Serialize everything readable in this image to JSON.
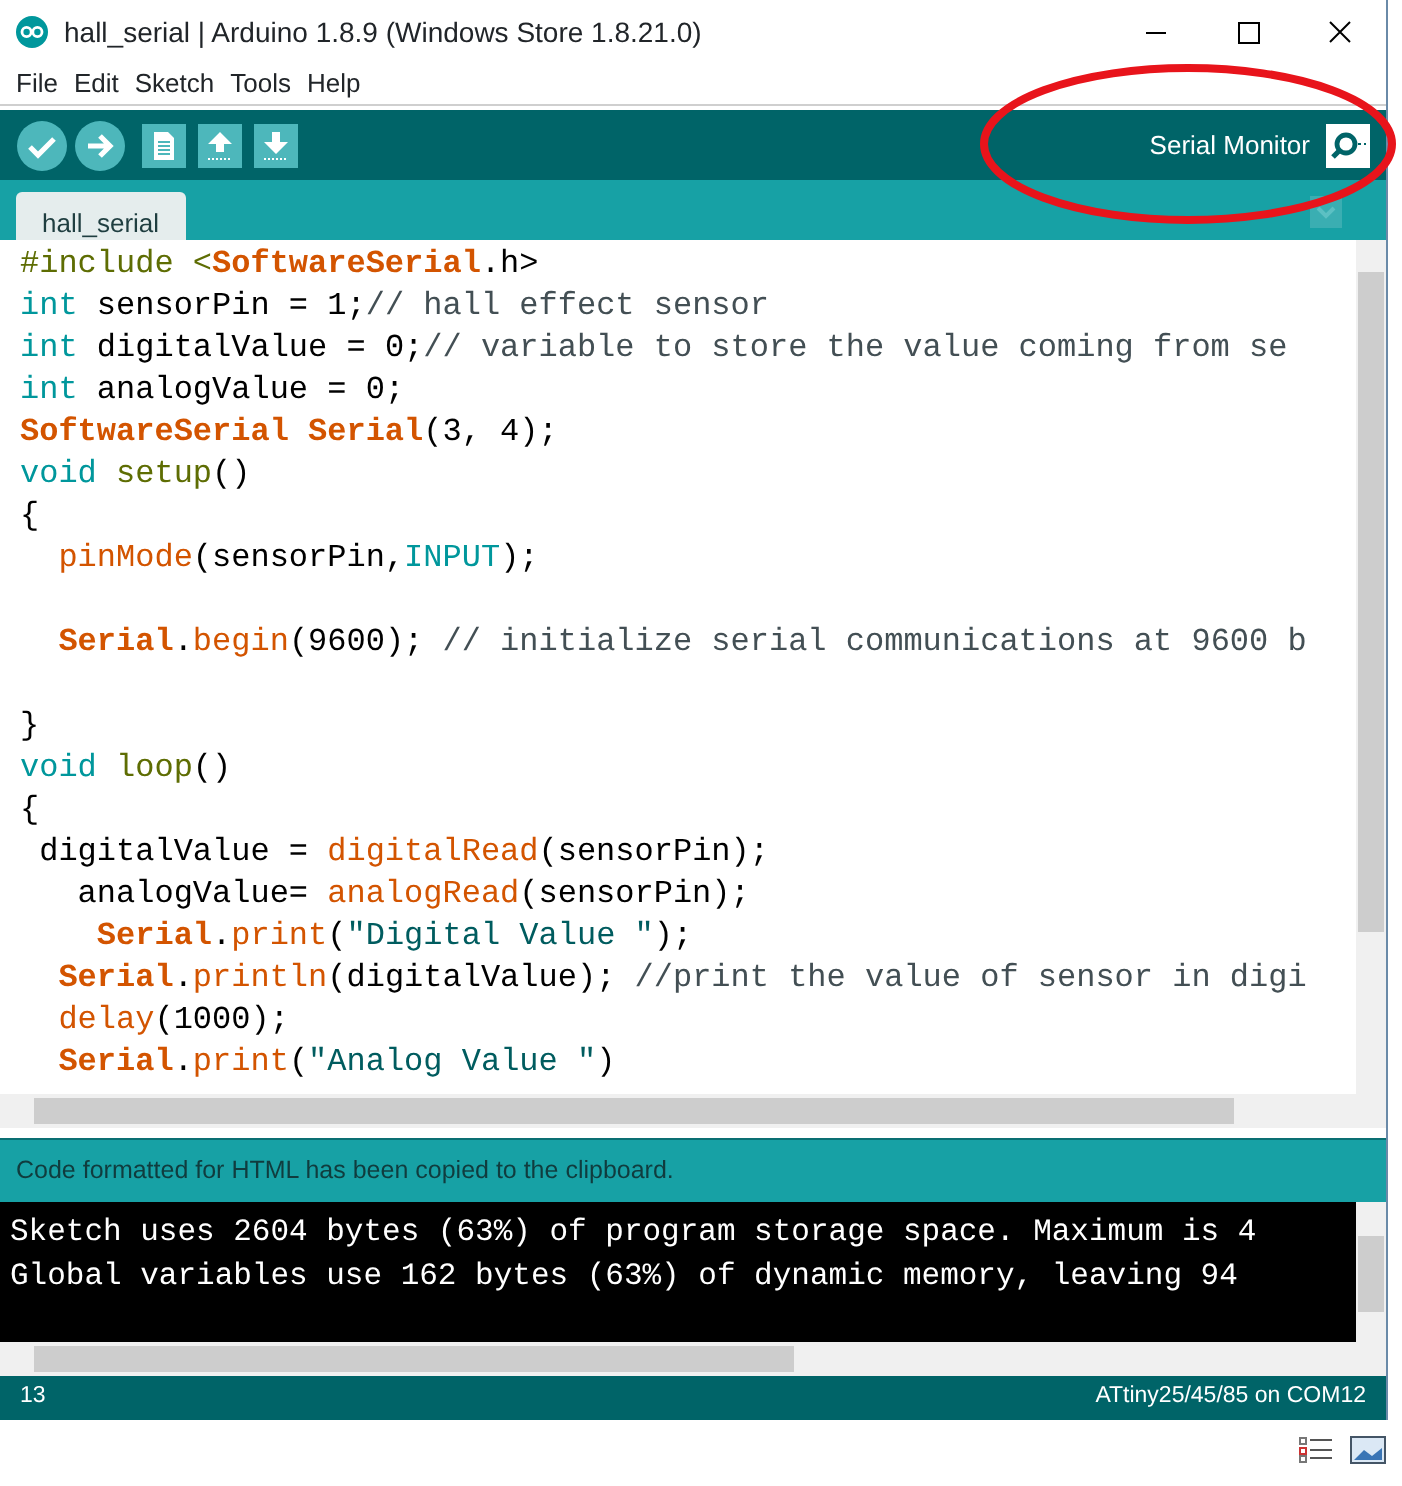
{
  "window": {
    "title": "hall_serial | Arduino 1.8.9 (Windows Store 1.8.21.0)"
  },
  "menu": [
    "File",
    "Edit",
    "Sketch",
    "Tools",
    "Help"
  ],
  "toolbar": {
    "serial_monitor_label": "Serial Monitor"
  },
  "tabs": [
    {
      "label": "hall_serial",
      "selected": true
    }
  ],
  "editor": {
    "lines": [
      {
        "kind": "code",
        "tokens": [
          {
            "kind": "preprocessor",
            "text": "#include <"
          },
          {
            "kind": "class",
            "text": "SoftwareSerial"
          },
          {
            "kind": "plain",
            "text": ".h>"
          }
        ]
      },
      {
        "kind": "code",
        "tokens": [
          {
            "kind": "type",
            "text": "int"
          },
          {
            "kind": "plain",
            "text": " sensorPin = 1;"
          },
          {
            "kind": "comment",
            "text": "// hall effect sensor"
          }
        ]
      },
      {
        "kind": "code",
        "tokens": [
          {
            "kind": "type",
            "text": "int"
          },
          {
            "kind": "plain",
            "text": " digitalValue = 0;"
          },
          {
            "kind": "comment",
            "text": "// variable to store the value coming from se"
          }
        ]
      },
      {
        "kind": "code",
        "tokens": [
          {
            "kind": "type",
            "text": "int"
          },
          {
            "kind": "plain",
            "text": " analogValue = 0;"
          }
        ]
      },
      {
        "kind": "code",
        "tokens": [
          {
            "kind": "class",
            "text": "SoftwareSerial"
          },
          {
            "kind": "class",
            "text": " Serial"
          },
          {
            "kind": "plain",
            "text": "(3, 4);"
          }
        ]
      },
      {
        "kind": "code",
        "tokens": [
          {
            "kind": "type",
            "text": "void"
          },
          {
            "kind": "definition",
            "text": " setup"
          },
          {
            "kind": "plain",
            "text": "()"
          }
        ]
      },
      {
        "kind": "code",
        "tokens": [
          {
            "kind": "plain",
            "text": "{"
          }
        ]
      },
      {
        "kind": "code",
        "tokens": [
          {
            "kind": "function",
            "text": "  pinMode"
          },
          {
            "kind": "plain",
            "text": "(sensorPin,"
          },
          {
            "kind": "type",
            "text": "INPUT"
          },
          {
            "kind": "plain",
            "text": ");"
          }
        ]
      },
      {
        "kind": "blank"
      },
      {
        "kind": "code",
        "tokens": [
          {
            "kind": "class",
            "text": "  Serial"
          },
          {
            "kind": "plain",
            "text": "."
          },
          {
            "kind": "function",
            "text": "begin"
          },
          {
            "kind": "plain",
            "text": "(9600); "
          },
          {
            "kind": "comment",
            "text": "// initialize serial communications at 9600 b"
          }
        ]
      },
      {
        "kind": "blank"
      },
      {
        "kind": "code",
        "tokens": [
          {
            "kind": "plain",
            "text": "}"
          }
        ]
      },
      {
        "kind": "code",
        "tokens": [
          {
            "kind": "type",
            "text": "void"
          },
          {
            "kind": "definition",
            "text": " loop"
          },
          {
            "kind": "plain",
            "text": "()"
          }
        ]
      },
      {
        "kind": "code",
        "tokens": [
          {
            "kind": "plain",
            "text": "{"
          }
        ]
      },
      {
        "kind": "code",
        "tokens": [
          {
            "kind": "plain",
            "text": " digitalValue = "
          },
          {
            "kind": "function",
            "text": "digitalRead"
          },
          {
            "kind": "plain",
            "text": "(sensorPin);"
          }
        ]
      },
      {
        "kind": "code",
        "tokens": [
          {
            "kind": "plain",
            "text": "   analogValue= "
          },
          {
            "kind": "function",
            "text": "analogRead"
          },
          {
            "kind": "plain",
            "text": "(sensorPin);"
          }
        ]
      },
      {
        "kind": "code",
        "tokens": [
          {
            "kind": "class",
            "text": "    Serial"
          },
          {
            "kind": "plain",
            "text": "."
          },
          {
            "kind": "function",
            "text": "print"
          },
          {
            "kind": "plain",
            "text": "("
          },
          {
            "kind": "string",
            "text": "\"Digital Value \""
          },
          {
            "kind": "plain",
            "text": ");"
          }
        ]
      },
      {
        "kind": "code",
        "tokens": [
          {
            "kind": "class",
            "text": "  Serial"
          },
          {
            "kind": "plain",
            "text": "."
          },
          {
            "kind": "function",
            "text": "println"
          },
          {
            "kind": "plain",
            "text": "(digitalValue); "
          },
          {
            "kind": "comment",
            "text": "//print the value of sensor in digi"
          }
        ]
      },
      {
        "kind": "code",
        "tokens": [
          {
            "kind": "function",
            "text": "  delay"
          },
          {
            "kind": "plain",
            "text": "(1000);"
          }
        ]
      },
      {
        "kind": "code",
        "tokens": [
          {
            "kind": "class",
            "text": "  Serial"
          },
          {
            "kind": "plain",
            "text": "."
          },
          {
            "kind": "function",
            "text": "print"
          },
          {
            "kind": "plain",
            "text": "("
          },
          {
            "kind": "string",
            "text": "\"Analog Value \""
          },
          {
            "kind": "plain",
            "text": ")"
          }
        ]
      }
    ]
  },
  "message": "Code formatted for HTML has been copied to the clipboard.",
  "console": {
    "lines": [
      "Sketch uses 2604 bytes (63%) of program storage space. Maximum is 4",
      "Global variables use 162 bytes (63%) of dynamic memory, leaving 94"
    ]
  },
  "status_bar": {
    "line": "13",
    "board": "ATtiny25/45/85 on COM12"
  },
  "annotation": {
    "kind": "ellipse",
    "color": "#e8141b"
  }
}
